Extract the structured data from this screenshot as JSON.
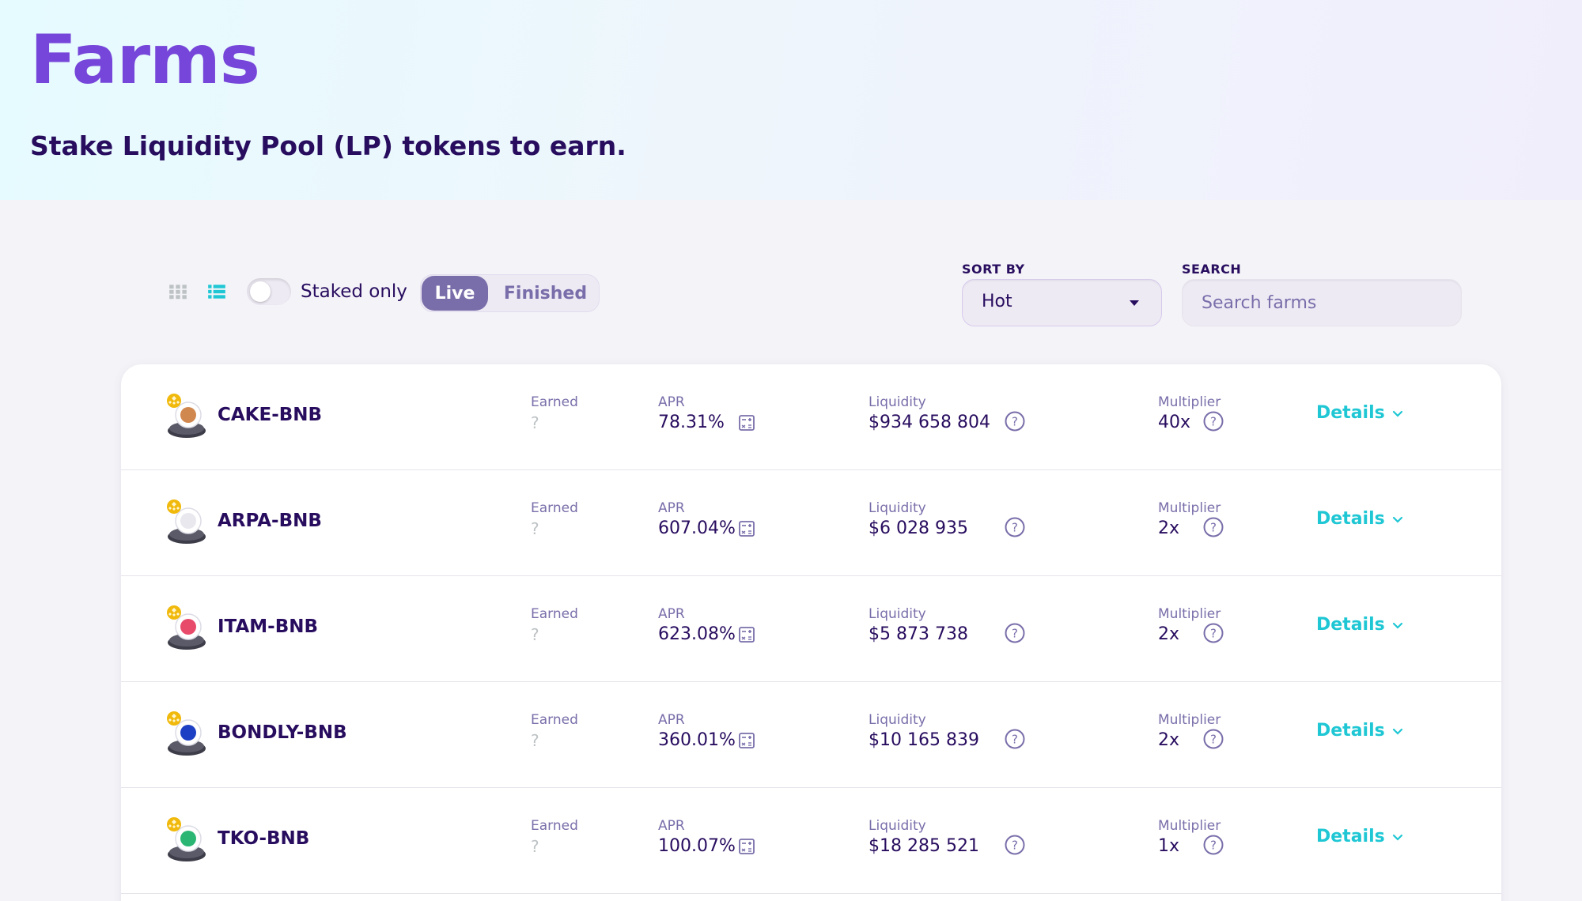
{
  "header": {
    "title": "Farms",
    "subtitle": "Stake Liquidity Pool (LP) tokens to earn."
  },
  "controls": {
    "staked_only_label": "Staked only",
    "staked_only": false,
    "status_tabs": [
      "Live",
      "Finished"
    ],
    "active_tab": "Live",
    "sort_label": "SORT BY",
    "sort_value": "Hot",
    "search_label": "SEARCH",
    "search_placeholder": "Search farms",
    "search_value": ""
  },
  "labels": {
    "earned": "Earned",
    "apr": "APR",
    "liquidity": "Liquidity",
    "multiplier": "Multiplier",
    "details": "Details"
  },
  "colors": {
    "primary": "#7645d9",
    "text": "#280d5f",
    "secondary": "#7a6eaa",
    "accent": "#1fc7d4"
  },
  "farms": [
    {
      "pair": "CAKE-BNB",
      "earned": "?",
      "apr": "78.31%",
      "liquidity": "$934 658 804",
      "multiplier": "40x",
      "token_icon": "cake-token-icon",
      "token_color": "#d1884f"
    },
    {
      "pair": "ARPA-BNB",
      "earned": "?",
      "apr": "607.04%",
      "liquidity": "$6 028 935",
      "multiplier": "2x",
      "token_icon": "arpa-token-icon",
      "token_color": "#e8e8ee"
    },
    {
      "pair": "ITAM-BNB",
      "earned": "?",
      "apr": "623.08%",
      "liquidity": "$5 873 738",
      "multiplier": "2x",
      "token_icon": "itam-token-icon",
      "token_color": "#e84b6a"
    },
    {
      "pair": "BONDLY-BNB",
      "earned": "?",
      "apr": "360.01%",
      "liquidity": "$10 165 839",
      "multiplier": "2x",
      "token_icon": "bondly-token-icon",
      "token_color": "#1d3fc4"
    },
    {
      "pair": "TKO-BNB",
      "earned": "?",
      "apr": "100.07%",
      "liquidity": "$18 285 521",
      "multiplier": "1x",
      "token_icon": "tko-token-icon",
      "token_color": "#2bb673"
    }
  ]
}
